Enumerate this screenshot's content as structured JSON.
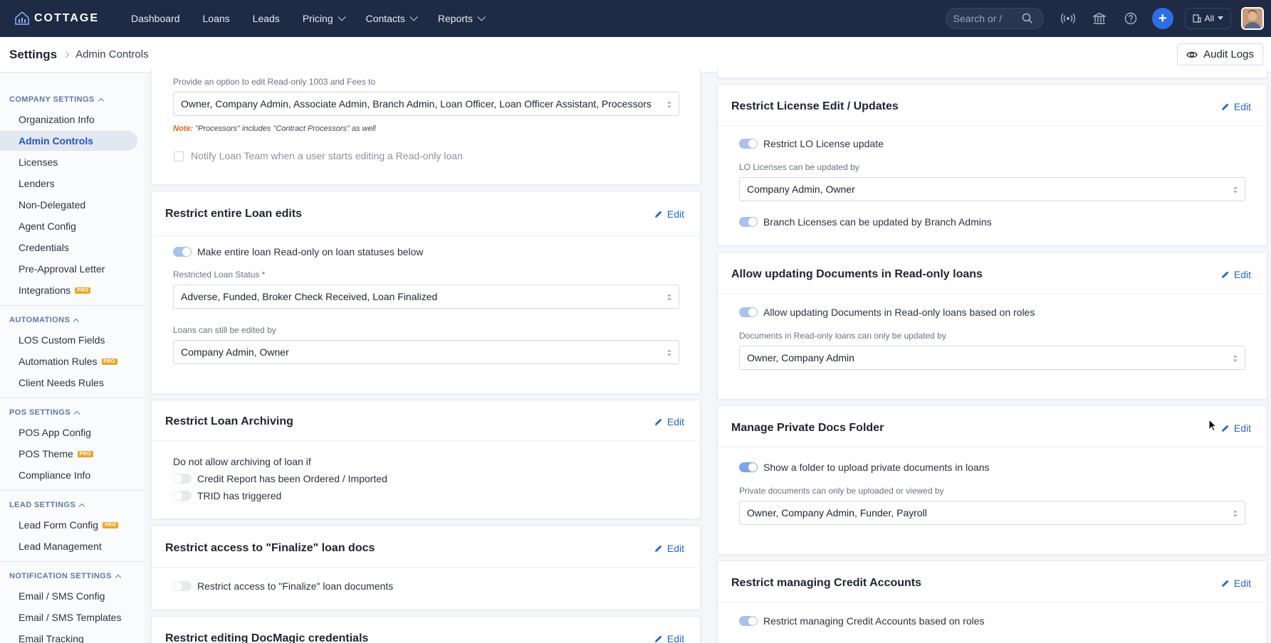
{
  "topnav": {
    "brand": "COTTAGE",
    "items": [
      {
        "label": "Dashboard",
        "dropdown": false
      },
      {
        "label": "Loans",
        "dropdown": false
      },
      {
        "label": "Leads",
        "dropdown": false
      },
      {
        "label": "Pricing",
        "dropdown": true
      },
      {
        "label": "Contacts",
        "dropdown": true
      },
      {
        "label": "Reports",
        "dropdown": true
      }
    ],
    "search_placeholder": "Search or /",
    "all_label": "All",
    "icons": [
      "broadcast-icon",
      "bank-icon",
      "help-icon",
      "plus-icon",
      "building-icon"
    ]
  },
  "subheader": {
    "root": "Settings",
    "current": "Admin Controls",
    "audit_logs": "Audit Logs"
  },
  "sidebar": {
    "sections": [
      {
        "title": "COMPANY SETTINGS",
        "items": [
          {
            "label": "Organization Info"
          },
          {
            "label": "Admin Controls",
            "active": true
          },
          {
            "label": "Licenses"
          },
          {
            "label": "Lenders"
          },
          {
            "label": "Non-Delegated"
          },
          {
            "label": "Agent Config"
          },
          {
            "label": "Credentials"
          },
          {
            "label": "Pre-Approval Letter"
          },
          {
            "label": "Integrations",
            "badge": "PRO"
          }
        ]
      },
      {
        "title": "AUTOMATIONS",
        "items": [
          {
            "label": "LOS Custom Fields"
          },
          {
            "label": "Automation Rules",
            "badge": "PRO"
          },
          {
            "label": "Client Needs Rules"
          }
        ]
      },
      {
        "title": "POS SETTINGS",
        "items": [
          {
            "label": "POS App Config"
          },
          {
            "label": "POS Theme",
            "badge": "PRO"
          },
          {
            "label": "Compliance Info"
          }
        ]
      },
      {
        "title": "LEAD SETTINGS",
        "items": [
          {
            "label": "Lead Form Config",
            "badge": "PRO"
          },
          {
            "label": "Lead Management"
          }
        ]
      },
      {
        "title": "NOTIFICATION SETTINGS",
        "items": [
          {
            "label": "Email / SMS Config"
          },
          {
            "label": "Email / SMS Templates"
          },
          {
            "label": "Email Tracking"
          }
        ]
      }
    ]
  },
  "cards": {
    "readonly": {
      "field_label": "Provide an option to edit Read-only 1003 and Fees to",
      "value": "Owner, Company Admin, Associate Admin, Branch Admin, Loan Officer, Loan Officer Assistant, Processors",
      "note_prefix": "Note:",
      "note_text": "\"Processors\" includes \"Contract Processors\" as well",
      "notify_label": "Notify Loan Team when a user starts editing a Read-only loan"
    },
    "entire_loan": {
      "title": "Restrict entire Loan edits",
      "edit": "Edit",
      "toggle_label": "Make entire loan Read-only on loan statuses below",
      "status_label": "Restricted Loan Status *",
      "status_value": "Adverse, Funded, Broker Check Received, Loan Finalized",
      "edited_by_label": "Loans can still be edited by",
      "edited_by_value": "Company Admin, Owner"
    },
    "archiving": {
      "title": "Restrict Loan Archiving",
      "edit": "Edit",
      "intro": "Do not allow archiving of loan if",
      "opt1": "Credit Report has been Ordered / Imported",
      "opt2": "TRID has triggered"
    },
    "finalize": {
      "title": "Restrict access to \"Finalize\" loan docs",
      "edit": "Edit",
      "toggle_label": "Restrict access to \"Finalize\" loan documents"
    },
    "docmagic": {
      "title": "Restrict editing DocMagic credentials",
      "edit": "Edit"
    },
    "license": {
      "title": "Restrict License Edit / Updates",
      "edit": "Edit",
      "toggle1": "Restrict LO License update",
      "field_label": "LO Licenses can be updated by",
      "value": "Company Admin, Owner",
      "toggle2": "Branch Licenses can be updated by Branch Admins"
    },
    "documents": {
      "title": "Allow updating Documents in Read-only loans",
      "edit": "Edit",
      "toggle_label": "Allow updating Documents in Read-only loans based on roles",
      "field_label": "Documents in Read-only loans can only be updated by",
      "value": "Owner, Company Admin"
    },
    "private_docs": {
      "title": "Manage Private Docs Folder",
      "edit": "Edit",
      "toggle_label": "Show a folder to upload private documents in loans",
      "field_label": "Private documents can only be uploaded or viewed by",
      "value": "Owner, Company Admin, Funder, Payroll"
    },
    "credit": {
      "title": "Restrict managing Credit Accounts",
      "edit": "Edit",
      "toggle_label": "Restrict managing Credit Accounts based on roles"
    }
  },
  "colors": {
    "nav_bg": "#1f2a44",
    "accent": "#1f66d1",
    "active_bg": "#e3e8f0",
    "pro_badge": "#e9a62b",
    "note": "#e0631b"
  }
}
